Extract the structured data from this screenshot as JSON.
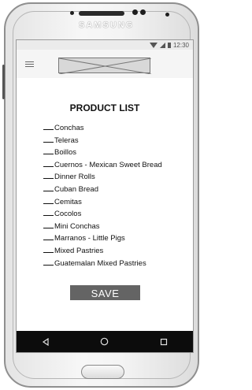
{
  "device": {
    "brand": "SAMSUNG"
  },
  "statusbar": {
    "time": "12:30"
  },
  "appbar": {
    "menu_icon": "menu-icon",
    "logo_placeholder": "image-placeholder"
  },
  "page": {
    "title": "PRODUCT LIST",
    "items": [
      "Conchas",
      "Teleras",
      "Boillos",
      "Cuernos - Mexican Sweet Bread",
      "Dinner Rolls",
      "Cuban Bread",
      "Cemitas",
      "Cocolos",
      "Mini Conchas",
      "Marranos - Little Pigs",
      "Mixed Pastries",
      "Guatemalan Mixed Pastries"
    ],
    "save_label": "SAVE"
  },
  "navbar": {
    "back_icon": "◁",
    "home_icon": "○",
    "recents_icon": "□"
  }
}
